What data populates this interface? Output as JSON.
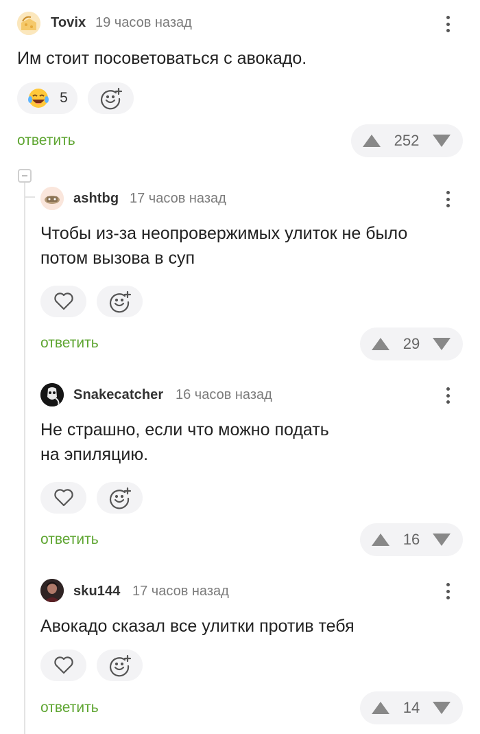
{
  "comments": [
    {
      "username": "Tovix",
      "time": "19 часов назад",
      "text": "Им стоит посоветоваться с авокадо.",
      "reaction_count": "5",
      "reply_label": "ответить",
      "score": "252"
    },
    {
      "username": "ashtbg",
      "time": "17 часов назад",
      "text_lines": [
        "Чтобы из-за неопровержимых улиток не было",
        "потом вызова в суп"
      ],
      "reply_label": "ответить",
      "score": "29"
    },
    {
      "username": "Snakecatcher",
      "time": "16 часов назад",
      "text_lines": [
        "Не страшно, если что можно подать",
        "на эпиляцию."
      ],
      "reply_label": "ответить",
      "score": "16"
    },
    {
      "username": "sku144",
      "time": "17 часов назад",
      "text": "Авокадо сказал все улитки против тебя",
      "reply_label": "ответить",
      "score": "14"
    }
  ],
  "icons": {
    "reaction": "laughing-emoji-icon",
    "add_reaction": "add-reaction-icon",
    "like": "heart-icon",
    "upvote": "triangle-up-icon",
    "downvote": "triangle-down-icon",
    "menu": "more-vertical-icon"
  },
  "colors": {
    "accent": "#5ea531",
    "pill_bg": "#f3f3f5",
    "thread_line": "#e3e3e3"
  }
}
